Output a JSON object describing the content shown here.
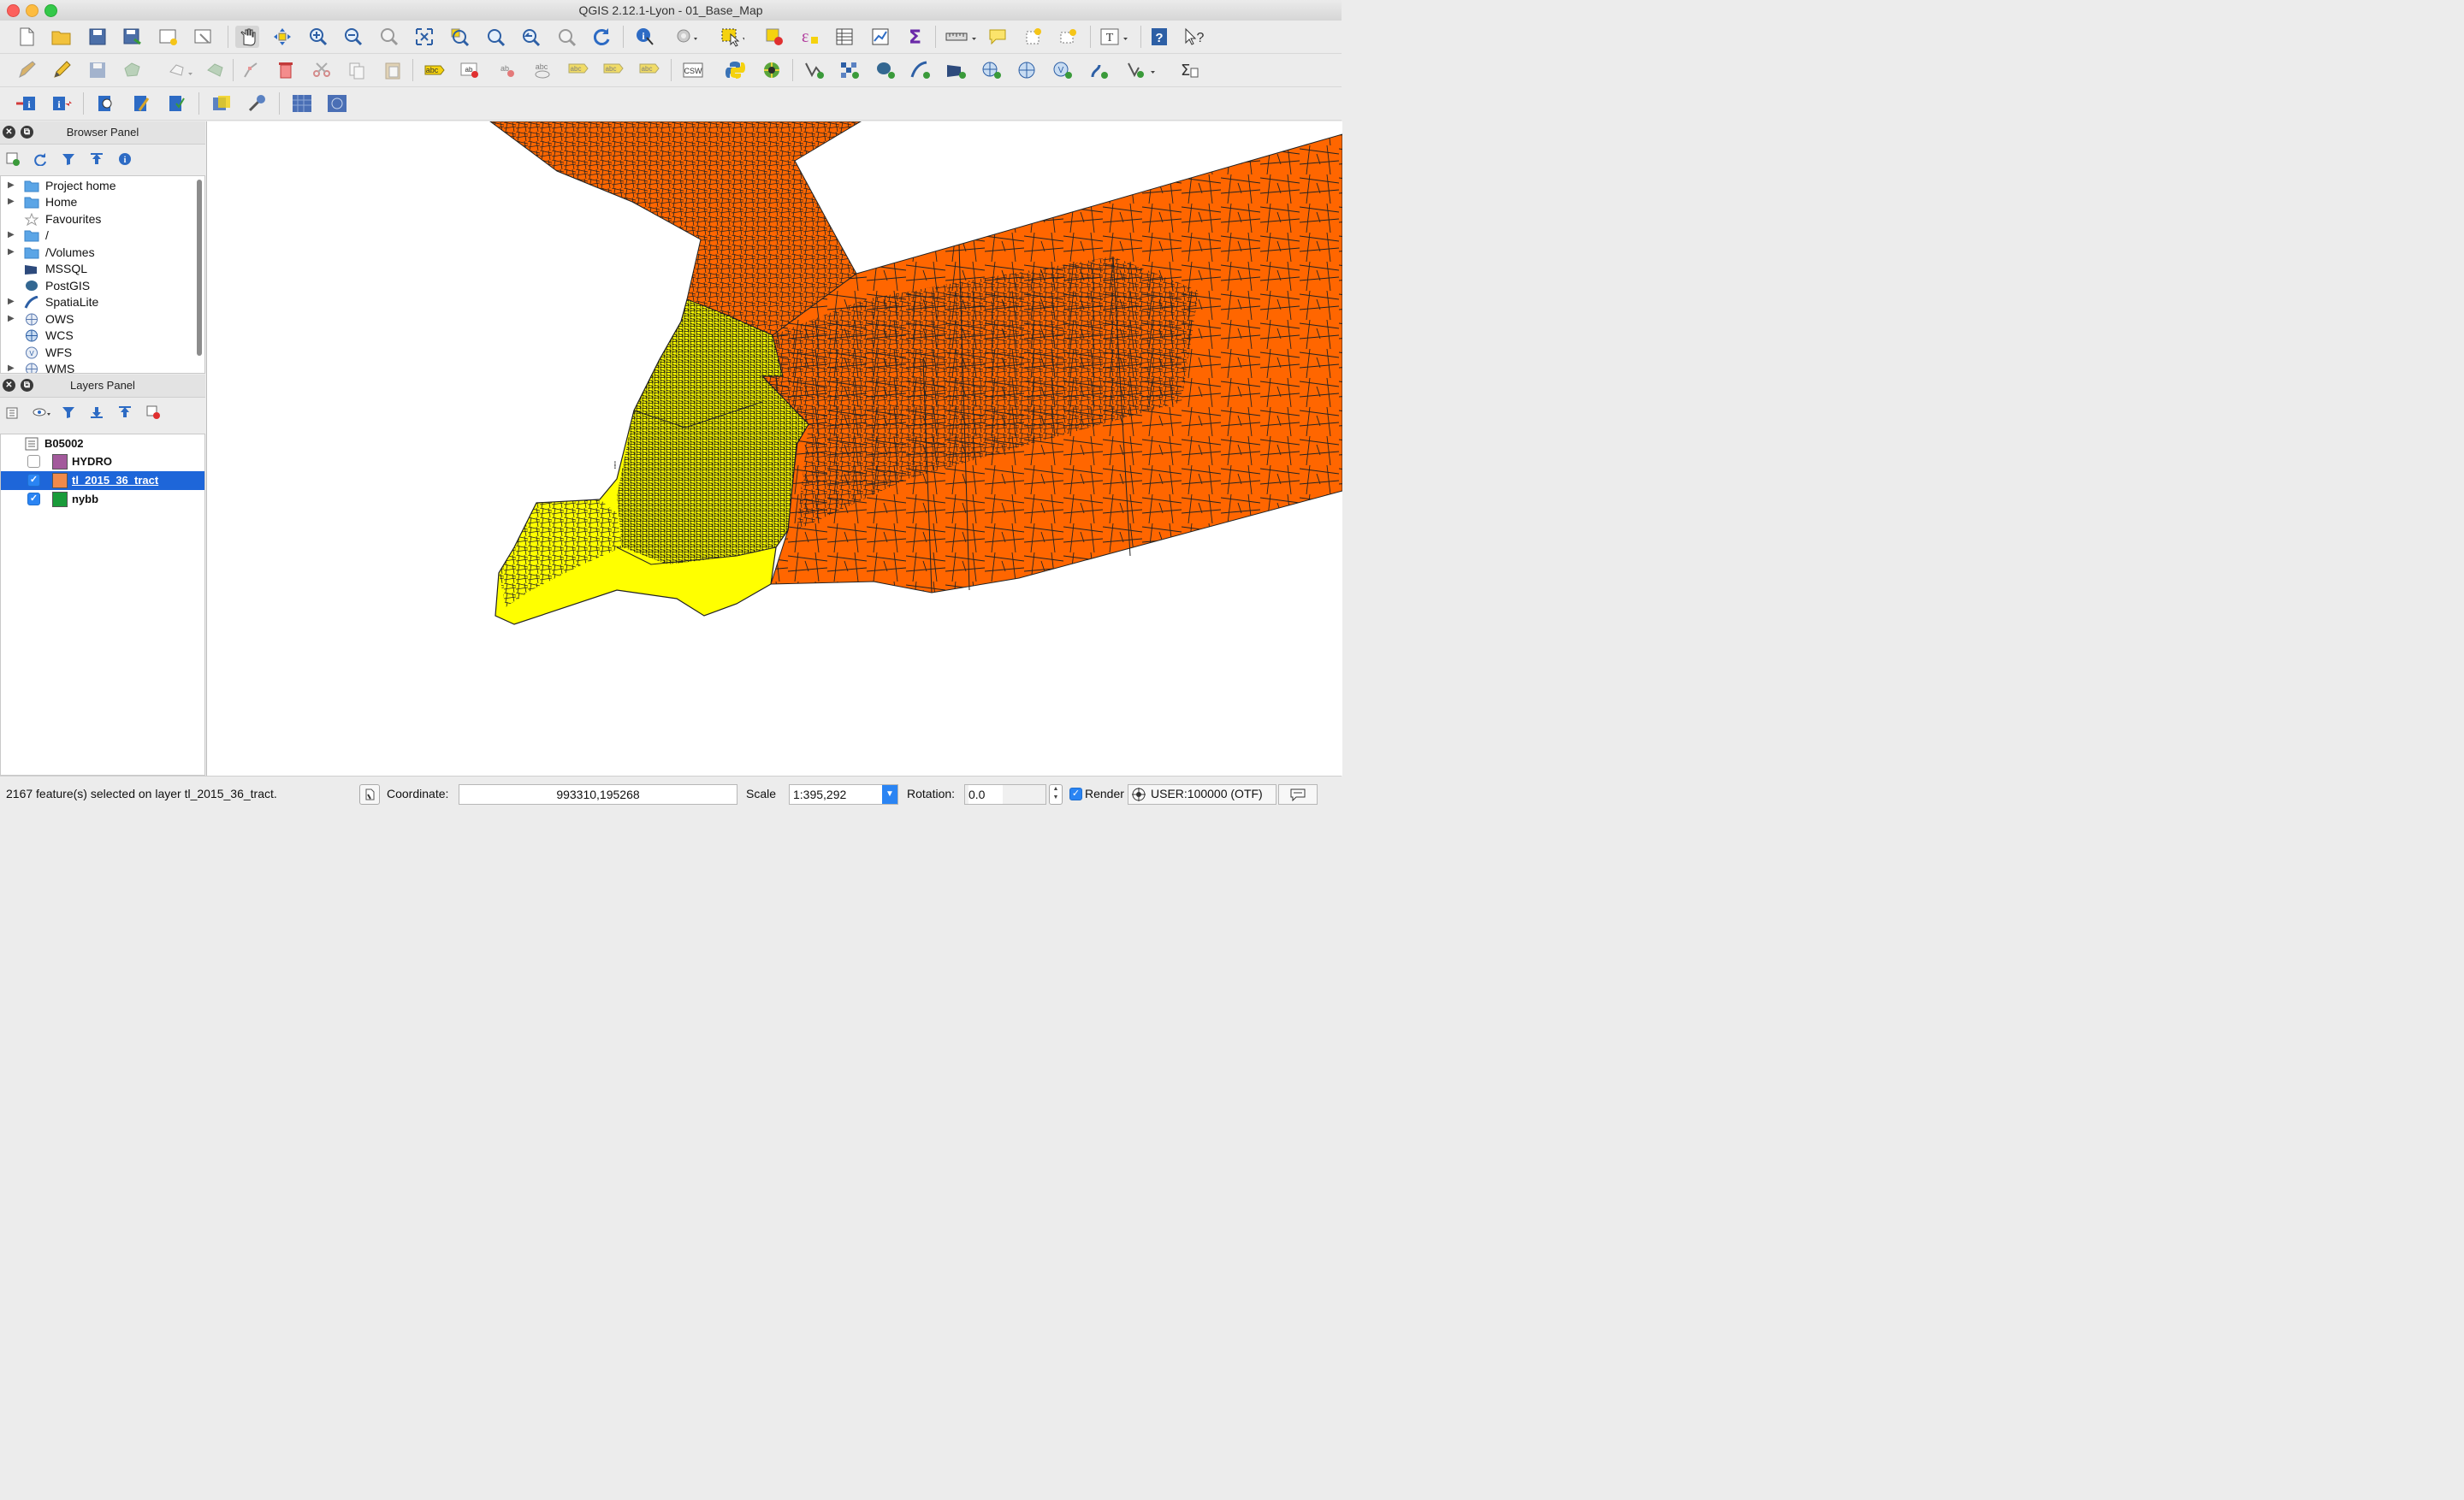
{
  "window": {
    "title": "QGIS 2.12.1-Lyon - 01_Base_Map"
  },
  "browser_panel": {
    "title": "Browser Panel",
    "items": [
      {
        "label": "Project home",
        "icon": "folder-icon",
        "expandable": true
      },
      {
        "label": "Home",
        "icon": "folder-icon",
        "expandable": true
      },
      {
        "label": "Favourites",
        "icon": "star-icon",
        "expandable": false
      },
      {
        "label": "/",
        "icon": "folder-icon",
        "expandable": true
      },
      {
        "label": "/Volumes",
        "icon": "folder-icon",
        "expandable": true
      },
      {
        "label": "MSSQL",
        "icon": "mssql-icon",
        "expandable": false
      },
      {
        "label": "PostGIS",
        "icon": "postgis-icon",
        "expandable": false
      },
      {
        "label": "SpatiaLite",
        "icon": "spatialite-icon",
        "expandable": true
      },
      {
        "label": "OWS",
        "icon": "globe-icon",
        "expandable": true
      },
      {
        "label": "WCS",
        "icon": "globe-icon",
        "expandable": false
      },
      {
        "label": "WFS",
        "icon": "wfs-icon",
        "expandable": false
      },
      {
        "label": "WMS",
        "icon": "globe-icon",
        "expandable": true
      }
    ]
  },
  "layers_panel": {
    "title": "Layers Panel",
    "group": {
      "label": "B05002"
    },
    "layers": [
      {
        "label": "HYDRO",
        "checked": false,
        "color": "#a35a9c",
        "selected": false
      },
      {
        "label": "tl_2015_36_tract",
        "checked": true,
        "color": "#f08a4b",
        "selected": true
      },
      {
        "label": "nybb",
        "checked": true,
        "color": "#1a9b3a",
        "selected": false
      }
    ]
  },
  "map": {
    "background": "#ffffff",
    "fill_orange": "#ff6600",
    "fill_yellow": "#ffff00",
    "outline": "#222222"
  },
  "status": {
    "message": "2167 feature(s) selected on layer tl_2015_36_tract.",
    "coordinate_label": "Coordinate:",
    "coordinate_value": "993310,195268",
    "scale_label": "Scale",
    "scale_value": "1:395,292",
    "rotation_label": "Rotation:",
    "rotation_value": "0.0",
    "render_label": "Render",
    "render_checked": true,
    "crs": "USER:100000 (OTF)"
  },
  "colors": {
    "selection": "#1e66d9",
    "close_red": "#fc605c",
    "minimize_yellow": "#fdbc40",
    "maximize_green": "#34c84a"
  }
}
